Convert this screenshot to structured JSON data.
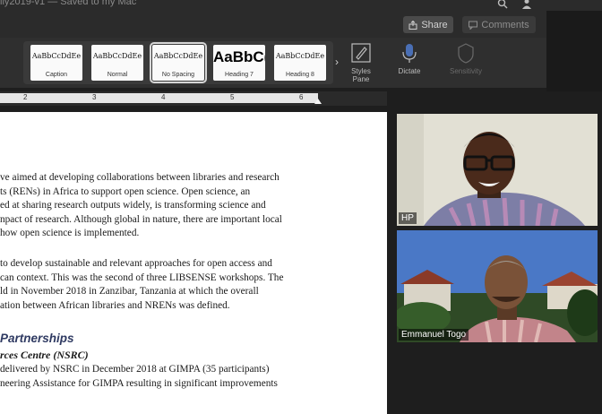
{
  "window": {
    "title": "lly2019-v1 — Saved to my Mac",
    "search_icon": "search-icon",
    "user_icon": "person-icon"
  },
  "toolbar": {
    "share_label": "Share",
    "comments_label": "Comments"
  },
  "ribbon": {
    "styles": [
      {
        "sample": "AaBbCcDdEe",
        "name": "Caption"
      },
      {
        "sample": "AaBbCcDdEe",
        "name": "Normal"
      },
      {
        "sample": "AaBbCcDdEe",
        "name": "No Spacing"
      },
      {
        "sample": "AaBbC(",
        "name": "Heading 7"
      },
      {
        "sample": "AaBbCcDdEe",
        "name": "Heading 8"
      }
    ],
    "selected_style": "No Spacing",
    "styles_pane_label": "Styles\nPane",
    "dictate_label": "Dictate",
    "sensitivity_label": "Sensitivity"
  },
  "ruler": {
    "numbers": [
      "2",
      "3",
      "4",
      "5",
      "6"
    ]
  },
  "document": {
    "para1": [
      "ve aimed at developing collaborations between libraries and research",
      "ts (RENs) in Africa to support open science. Open science, an",
      "ed at sharing research outputs widely, is transforming science and",
      "npact of research. Although global in nature, there are important local",
      "how open science is implemented."
    ],
    "para2": [
      "to develop sustainable and relevant approaches for open access and",
      "can context.  This was the second of three LIBSENSE workshops. The",
      "ld in November 2018 in Zanzibar, Tanzania at which the overall",
      "ation between African libraries and NRENs was defined."
    ],
    "heading1": "Partnerships",
    "heading2": "rces Centre (NSRC)",
    "para3": [
      "delivered by NSRC in December 2018 at GIMPA (35 participants)",
      "neering Assistance for GIMPA resulting in significant improvements"
    ]
  },
  "participants": [
    {
      "name": "HP"
    },
    {
      "name": "Emmanuel Togo"
    }
  ]
}
